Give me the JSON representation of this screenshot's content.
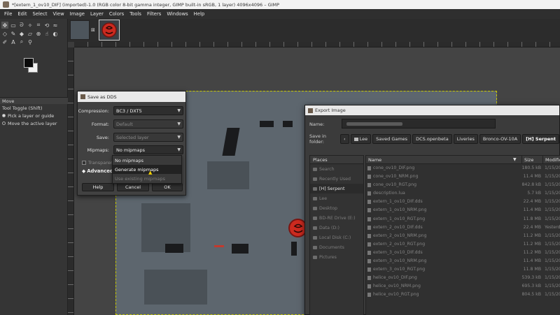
{
  "window": {
    "title": "*[extern_1_ov10_DIF] (imported)-1.0 (RGB color 8-bit gamma integer, GIMP built-in sRGB, 1 layer) 4096x4096 – GIMP"
  },
  "menubar": [
    "File",
    "Edit",
    "Select",
    "View",
    "Image",
    "Layer",
    "Colors",
    "Tools",
    "Filters",
    "Windows",
    "Help"
  ],
  "tool_options": {
    "title": "Move",
    "toggle_label": "Tool Toggle  (Shift)",
    "option_pick": "Pick a layer or guide",
    "option_move": "Move the active layer"
  },
  "image_tabs": {
    "close_symbol": "⊠"
  },
  "dds_dialog": {
    "title": "Save as DDS",
    "compression_label": "Compression:",
    "compression_value": "BC3 / DXT5",
    "format_label": "Format:",
    "format_value": "Default",
    "save_label": "Save:",
    "save_value": "Selected layer",
    "mipmaps_label": "Mipmaps:",
    "mipmaps_value": "No mipmaps",
    "transparent_label": "Transparent",
    "advanced_label": "Advanced",
    "help_button": "Help",
    "cancel_button": "Cancel",
    "ok_button": "OK",
    "mipmap_options": [
      "No mipmaps",
      "Generate mipmaps",
      "Use existing mipmaps"
    ]
  },
  "export_dialog": {
    "title": "Export Image",
    "name_label": "Name:",
    "save_in_label": "Save in folder:",
    "breadcrumbs": [
      "Lee",
      "Saved Games",
      "DCS.openbeta",
      "Liveries",
      "Bronco-OV-10A",
      "[H] Serpent"
    ],
    "places_header": "Places",
    "places": [
      "Search",
      "Recently Used",
      "[H] Serpent",
      "Lee",
      "Desktop",
      "BD-RE Drive (E:)",
      "Data (D:)",
      "Local Disk (C:)",
      "Documents",
      "Pictures"
    ],
    "columns": {
      "name": "Name",
      "size": "Size",
      "modified": "Modified"
    },
    "files": [
      {
        "name": "cone_ov10_DIF.png",
        "size": "180.5 kB",
        "modified": "1/15/20"
      },
      {
        "name": "cone_ov10_NRM.png",
        "size": "11.4 MB",
        "modified": "1/15/20"
      },
      {
        "name": "cone_ov10_RGT.png",
        "size": "842.8 kB",
        "modified": "1/15/20"
      },
      {
        "name": "description.lua",
        "size": "5.7 kB",
        "modified": "1/15/20"
      },
      {
        "name": "extern_1_ov10_DIF.dds",
        "size": "22.4 MB",
        "modified": "1/15/20"
      },
      {
        "name": "extern_1_ov10_NRM.png",
        "size": "11.4 MB",
        "modified": "1/15/20"
      },
      {
        "name": "extern_1_ov10_RGT.png",
        "size": "11.8 MB",
        "modified": "1/15/20"
      },
      {
        "name": "extern_2_ov10_DIF.dds",
        "size": "22.4 MB",
        "modified": "Yesterd"
      },
      {
        "name": "extern_2_ov10_NRM.png",
        "size": "11.2 MB",
        "modified": "1/15/20"
      },
      {
        "name": "extern_2_ov10_RGT.png",
        "size": "11.2 MB",
        "modified": "1/15/20"
      },
      {
        "name": "extern_3_ov10_DIF.dds",
        "size": "11.2 MB",
        "modified": "1/15/20"
      },
      {
        "name": "extern_3_ov10_NRM.png",
        "size": "11.4 MB",
        "modified": "1/15/20"
      },
      {
        "name": "extern_3_ov10_RGT.png",
        "size": "11.8 MB",
        "modified": "1/15/20"
      },
      {
        "name": "helice_ov10_DIF.png",
        "size": "539.3 kB",
        "modified": "1/15/20"
      },
      {
        "name": "helice_ov10_NRM.png",
        "size": "695.3 kB",
        "modified": "1/15/20"
      },
      {
        "name": "helice_ov10_RGT.png",
        "size": "804.5 kB",
        "modified": "1/15/20"
      }
    ]
  },
  "colors": {
    "dialog_bg": "#414141",
    "accent_selection": "#c8c800",
    "emblem_red": "#cc2a1f"
  }
}
